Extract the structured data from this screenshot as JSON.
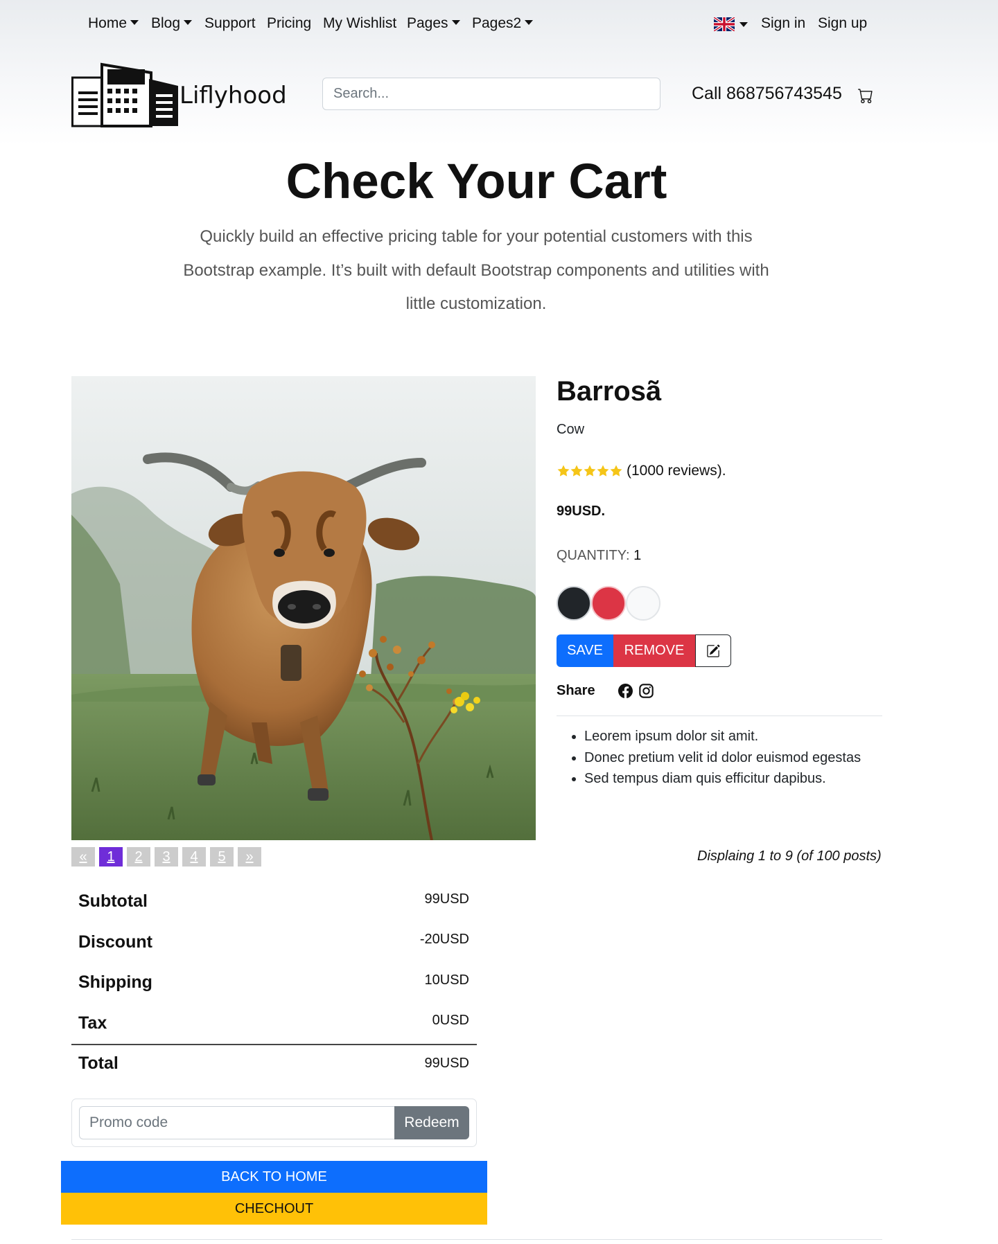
{
  "nav": {
    "items": [
      {
        "label": "Home",
        "dropdown": true
      },
      {
        "label": "Blog",
        "dropdown": true
      },
      {
        "label": "Support",
        "dropdown": false
      },
      {
        "label": "Pricing",
        "dropdown": false
      },
      {
        "label": "My Wishlist",
        "dropdown": false
      },
      {
        "label": "Pages",
        "dropdown": true
      },
      {
        "label": "Pages2",
        "dropdown": true
      }
    ],
    "language_icon": "uk-flag-icon",
    "sign_in": "Sign in",
    "sign_up": "Sign up"
  },
  "header": {
    "brand": "Liflyhood",
    "search_placeholder": "Search...",
    "call": "Call 868756743545",
    "cart_icon": "cart-icon"
  },
  "hero": {
    "title": "Check Your Cart",
    "text": "Quickly build an effective pricing table for your potential customers with this Bootstrap example. It’s built with default Bootstrap components and utilities with little customization."
  },
  "product": {
    "title": "Barrosã",
    "category": "Cow",
    "rating": 5,
    "rating_max": 5,
    "reviews": "(1000 reviews).",
    "price": "99USD.",
    "quantity_label": "QUANTITY:",
    "quantity": "1",
    "swatches": [
      "#212529",
      "#dc3545",
      "#f8f9fa"
    ],
    "buttons": {
      "save": "SAVE",
      "remove": "REMOVE",
      "edit_icon": "edit-icon"
    },
    "share_label": "Share",
    "share_icons": [
      "facebook-icon",
      "instagram-icon"
    ],
    "features": [
      "Leorem ipsum dolor sit amit.",
      "Donec pretium velit id dolor euismod egestas",
      "Sed tempus diam quis efficitur dapibus."
    ]
  },
  "pagination": {
    "prev": "«",
    "pages": [
      "1",
      "2",
      "3",
      "4",
      "5"
    ],
    "active": "1",
    "next": "»",
    "displaying": "Displaing 1 to 9 (of 100 posts)"
  },
  "totals": [
    {
      "label": "Subtotal",
      "value": "99USD"
    },
    {
      "label": "Discount",
      "value": "-20USD"
    },
    {
      "label": "Shipping",
      "value": "10USD"
    },
    {
      "label": "Tax",
      "value": "0USD"
    },
    {
      "label": "Total",
      "value": "99USD"
    }
  ],
  "promo": {
    "placeholder": "Promo code",
    "button": "Redeem"
  },
  "actions": {
    "back": "BACK TO HOME",
    "checkout": "CHECHOUT"
  },
  "colors": {
    "primary": "#0d6efd",
    "danger": "#dc3545",
    "warning": "#ffc107",
    "secondary": "#6c757d",
    "active_page": "#6f2dd8"
  }
}
